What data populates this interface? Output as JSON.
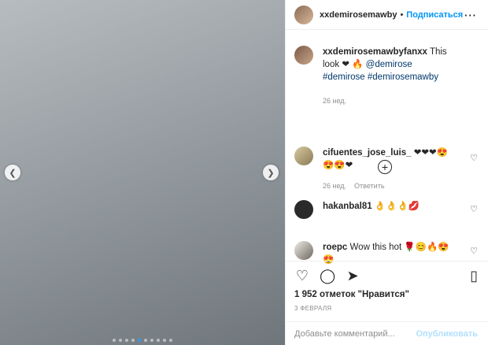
{
  "post": {
    "author": "xxdemirosemawby",
    "separator": "•",
    "follow_label": "Подписаться",
    "more_icon": "more-icon"
  },
  "caption": {
    "user": "xxdemirosemawbyfanxx",
    "text": "This look",
    "mention": "@demirose",
    "hashtags": "#demirose #demirosemawby",
    "time": "26 нед."
  },
  "load_more_icon": "plus-circle-icon",
  "comments": [
    {
      "user": "cifuentes_jose_luis_",
      "text": "❤❤❤😍 😍😍❤",
      "time": "26 нед.",
      "reply": "Ответить"
    },
    {
      "user": "hakanbal81",
      "text": "👌👌👌💋",
      "time": "",
      "reply": ""
    },
    {
      "user": "roepc",
      "text": "Wow this hot 🌹😊🔥😍 😍",
      "time": "",
      "reply": ""
    }
  ],
  "actions": {
    "like_icon": "heart-icon",
    "comment_icon": "comment-icon",
    "share_icon": "share-icon",
    "save_icon": "bookmark-icon",
    "likes": "1 952 отметок \"Нравится\"",
    "date": "3 ФЕВРАЛЯ"
  },
  "composer": {
    "placeholder": "Добавьте комментарий...",
    "publish_label": "Опубликовать"
  },
  "carousel": {
    "total": 10,
    "active": 4
  }
}
